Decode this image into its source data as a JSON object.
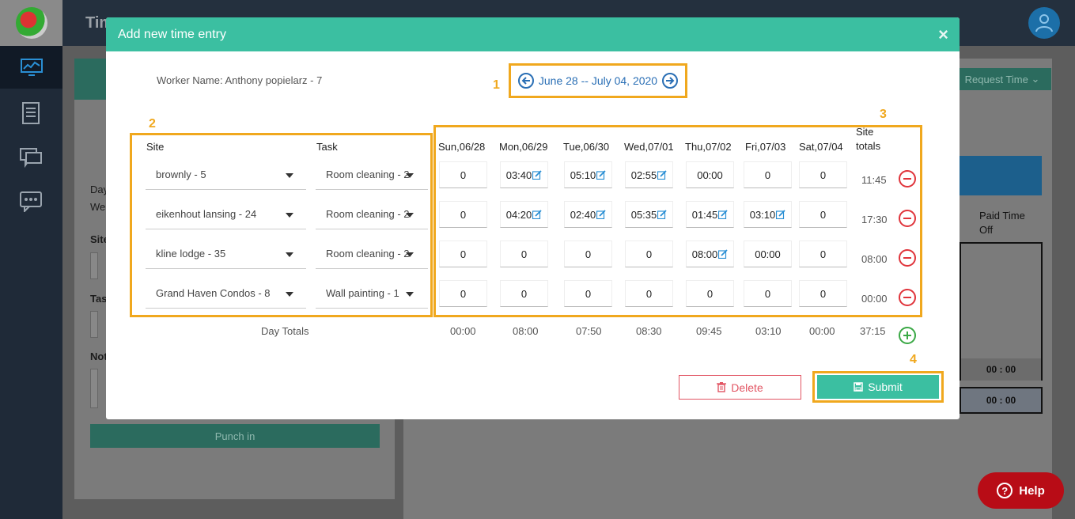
{
  "app": {
    "topbar_title": "Tim",
    "bg_request_label": "Request Time",
    "bg_punch_label": "Punch in",
    "bg_paid_label": "Paid Time Off",
    "bg_totals": [
      "00 : 00",
      "00 : 00"
    ],
    "bg_labels": [
      "Day",
      "We",
      "Site",
      "Tas",
      "Not"
    ]
  },
  "modal": {
    "title": "Add new time entry",
    "close": "×",
    "worker_label": "Worker Name: Anthony popielarz - 7",
    "week_range": "June 28 -- July 04, 2020",
    "callouts": [
      "1",
      "2",
      "3",
      "4"
    ],
    "columns": {
      "site": "Site",
      "task": "Task",
      "days": [
        "Sun,06/28",
        "Mon,06/29",
        "Tue,06/30",
        "Wed,07/01",
        "Thu,07/02",
        "Fri,07/03",
        "Sat,07/04"
      ],
      "site_totals": "Site totals"
    },
    "rows": [
      {
        "site": "brownly - 5",
        "task": "Room cleaning - 2",
        "times": [
          "0",
          "03:40",
          "05:10",
          "02:55",
          "00:00",
          "0",
          "0"
        ],
        "edited": [
          false,
          true,
          true,
          true,
          false,
          false,
          false
        ],
        "total": "11:45"
      },
      {
        "site": "eikenhout lansing - 24",
        "task": "Room cleaning - 2",
        "times": [
          "0",
          "04:20",
          "02:40",
          "05:35",
          "01:45",
          "03:10",
          "0"
        ],
        "edited": [
          false,
          true,
          true,
          true,
          true,
          true,
          false
        ],
        "total": "17:30"
      },
      {
        "site": "kline lodge - 35",
        "task": "Room cleaning - 2",
        "times": [
          "0",
          "0",
          "0",
          "0",
          "08:00",
          "00:00",
          "0"
        ],
        "edited": [
          false,
          false,
          false,
          false,
          true,
          false,
          false
        ],
        "total": "08:00"
      },
      {
        "site": "Grand Haven Condos - 8",
        "task": "Wall painting - 1",
        "times": [
          "0",
          "0",
          "0",
          "0",
          "0",
          "0",
          "0"
        ],
        "edited": [
          false,
          false,
          false,
          false,
          false,
          false,
          false
        ],
        "total": "00:00"
      }
    ],
    "day_totals_label": "Day Totals",
    "day_totals": [
      "00:00",
      "08:00",
      "07:50",
      "08:30",
      "09:45",
      "03:10",
      "00:00"
    ],
    "grand_total": "37:15",
    "delete_label": "Delete",
    "submit_label": "Submit"
  },
  "help_label": "Help",
  "colors": {
    "accent": "#3bbfa1",
    "highlight": "#f0a81e",
    "link": "#2a6fb5",
    "danger": "#e0343b",
    "add": "#3aa845"
  }
}
